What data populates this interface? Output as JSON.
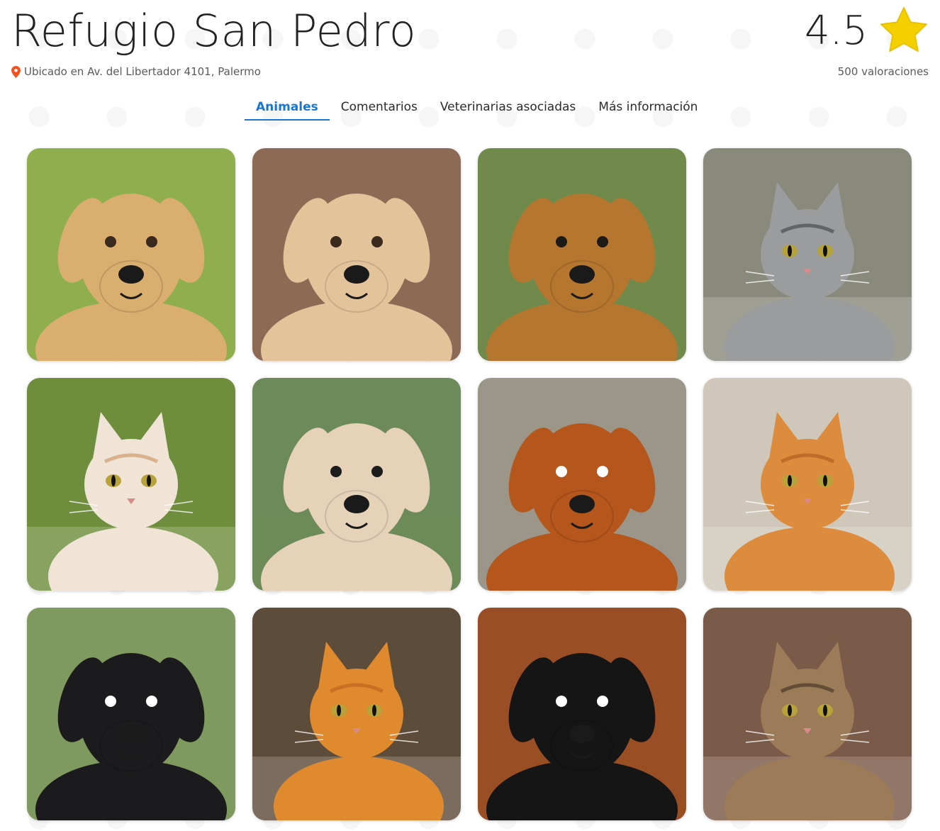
{
  "shelter": {
    "name": "Refugio San Pedro",
    "location": "Ubicado en Av. del Libertador 4101, Palermo",
    "location_icon": "map-pin-icon",
    "rating": "4.5",
    "rating_icon": "star-icon",
    "reviews": "500 valoraciones"
  },
  "tabs": [
    {
      "label": "Animales",
      "active": true
    },
    {
      "label": "Comentarios",
      "active": false
    },
    {
      "label": "Veterinarias asociadas",
      "active": false
    },
    {
      "label": "Más información",
      "active": false
    }
  ],
  "colors": {
    "accent": "#1976d2",
    "star": "#f5d000",
    "pin": "#f4511e"
  },
  "animals": [
    {
      "species": "dog",
      "bg": "#8fae4e",
      "fur": "#d9ae6e",
      "dark": "#3a2a1e"
    },
    {
      "species": "dog",
      "bg": "#8c6a55",
      "fur": "#e3c49a",
      "dark": "#3a2a1e"
    },
    {
      "species": "dog",
      "bg": "#6f8a4a",
      "fur": "#b5762f",
      "dark": "#1e1a17"
    },
    {
      "species": "cat",
      "bg": "#8a8a7c",
      "fur": "#9a9c9e",
      "dark": "#3e4044"
    },
    {
      "species": "cat",
      "bg": "#6e8e3e",
      "fur": "#efe4d6",
      "dark": "#c9905a"
    },
    {
      "species": "dog",
      "bg": "#6d8a5a",
      "fur": "#e6d2b8",
      "dark": "#1c1c1c"
    },
    {
      "species": "dog",
      "bg": "#9c9689",
      "fur": "#b5561c",
      "dark": "#ffffff"
    },
    {
      "species": "cat",
      "bg": "#cfc7ba",
      "fur": "#dd8b3c",
      "dark": "#a85a1c"
    },
    {
      "species": "dog",
      "bg": "#7f9a5e",
      "fur": "#1b1b1d",
      "dark": "#ffffff"
    },
    {
      "species": "cat",
      "bg": "#5e4c3a",
      "fur": "#e08a2f",
      "dark": "#b55e1a"
    },
    {
      "species": "dog",
      "bg": "#9a4e25",
      "fur": "#151515",
      "dark": "#ffffff"
    },
    {
      "species": "cat",
      "bg": "#7a5a48",
      "fur": "#9c7b58",
      "dark": "#3e2e22"
    }
  ]
}
